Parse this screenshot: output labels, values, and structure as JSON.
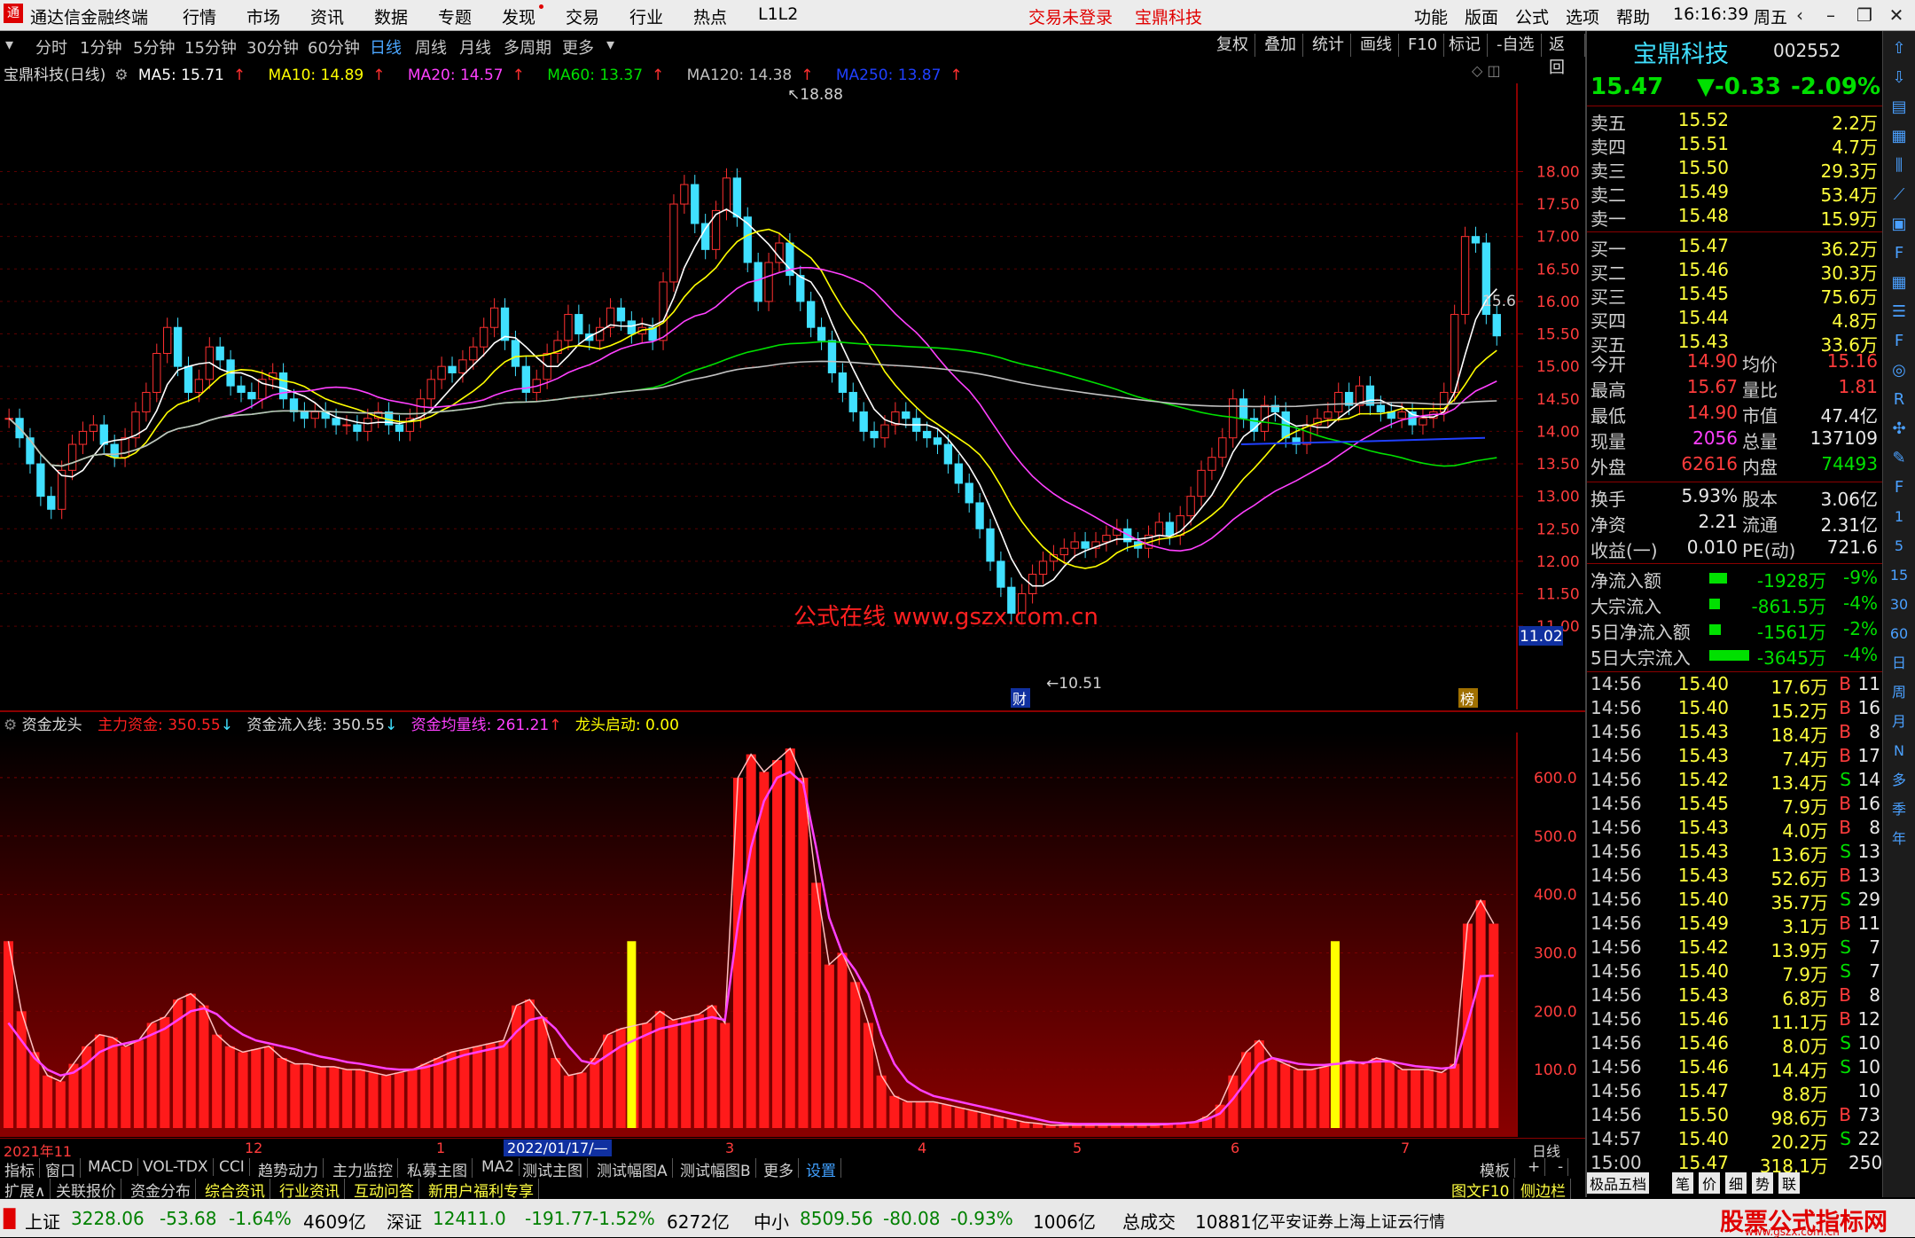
{
  "menubar": {
    "app_title": "通达信金融终端",
    "items": [
      "行情",
      "市场",
      "资讯",
      "数据",
      "专题",
      "发现",
      "交易",
      "行业",
      "热点",
      "L1L2"
    ],
    "notice1": "交易未登录",
    "notice2": "宝鼎科技",
    "right_items": [
      "功能",
      "版面",
      "公式",
      "选项",
      "帮助"
    ],
    "time": "16:16:39",
    "weekday": "周五"
  },
  "period": {
    "tabs": [
      "分时",
      "1分钟",
      "5分钟",
      "15分钟",
      "30分钟",
      "60分钟",
      "日线",
      "周线",
      "月线",
      "多周期",
      "更多"
    ],
    "active": "日线",
    "tools": [
      "复权",
      "叠加",
      "统计",
      "画线",
      "F10",
      "标记",
      "-自选",
      "返回"
    ]
  },
  "ma": {
    "title": "宝鼎科技(日线)",
    "items": [
      {
        "label": "MA5: 15.71",
        "color": "#ffffff"
      },
      {
        "label": "MA10: 14.89",
        "color": "#ffff00"
      },
      {
        "label": "MA20: 14.57",
        "color": "#ff40ff"
      },
      {
        "label": "MA60: 13.37",
        "color": "#00e000"
      },
      {
        "label": "MA120: 14.38",
        "color": "#c0c0c0"
      },
      {
        "label": "MA250: 13.87",
        "color": "#2040ff"
      }
    ]
  },
  "kline": {
    "y_ticks": [
      "18.00",
      "17.50",
      "17.00",
      "16.50",
      "16.00",
      "15.50",
      "15.00",
      "14.50",
      "14.00",
      "13.50",
      "13.00",
      "12.50",
      "12.00",
      "11.50",
      "11.02",
      "11.00"
    ],
    "high_label": "18.88",
    "low_label": "10.51",
    "last_label": "15.6",
    "current_price_box": "11.02",
    "watermark": "公式在线   www.gszx.com.cn",
    "marker1": "财",
    "marker2": "榜"
  },
  "indicator": {
    "name": "资金龙头",
    "items": [
      {
        "label": "主力资金: 350.55",
        "color": "#ff2020"
      },
      {
        "label": "资金流入线: 350.55",
        "color": "#d8d8d8"
      },
      {
        "label": "资金均量线: 261.21",
        "color": "#ff40ff"
      },
      {
        "label": "龙头启动: 0.00",
        "color": "#ffff00"
      }
    ],
    "y_ticks": [
      "600.0",
      "500.0",
      "400.0",
      "300.0",
      "200.0",
      "100.0"
    ]
  },
  "chart_data": {
    "type": "bar",
    "title": "资金龙头",
    "series": [
      {
        "name": "主力资金",
        "values": [
          320,
          200,
          130,
          90,
          80,
          110,
          140,
          160,
          155,
          140,
          150,
          180,
          190,
          220,
          230,
          210,
          160,
          140,
          130,
          135,
          140,
          120,
          110,
          110,
          105,
          105,
          100,
          100,
          95,
          90,
          95,
          100,
          110,
          120,
          130,
          135,
          140,
          145,
          150,
          210,
          220,
          190,
          120,
          90,
          95,
          120,
          160,
          170,
          175,
          180,
          200,
          185,
          190,
          195,
          210,
          180,
          600,
          640,
          610,
          630,
          650,
          600,
          420,
          280,
          300,
          250,
          180,
          90,
          55,
          45,
          45,
          45,
          40,
          35,
          30,
          25,
          20,
          15,
          10,
          8,
          5,
          5,
          5,
          5,
          5,
          5,
          5,
          5,
          5,
          6,
          8,
          10,
          20,
          40,
          90,
          130,
          150,
          120,
          110,
          100,
          100,
          105,
          110,
          115,
          110,
          120,
          115,
          100,
          100,
          100,
          95,
          110,
          350,
          390,
          350
        ]
      },
      {
        "name": "资金均量线",
        "values": [
          180,
          150,
          120,
          100,
          90,
          95,
          110,
          130,
          140,
          145,
          150,
          160,
          170,
          185,
          200,
          205,
          195,
          175,
          160,
          150,
          145,
          140,
          135,
          128,
          122,
          118,
          113,
          110,
          106,
          102,
          100,
          100,
          104,
          110,
          118,
          125,
          130,
          135,
          140,
          165,
          185,
          190,
          170,
          140,
          115,
          110,
          125,
          140,
          150,
          160,
          170,
          175,
          180,
          185,
          190,
          185,
          350,
          480,
          560,
          600,
          610,
          590,
          480,
          360,
          300,
          270,
          230,
          160,
          110,
          80,
          65,
          55,
          50,
          45,
          40,
          35,
          30,
          25,
          20,
          15,
          10,
          8,
          7,
          7,
          7,
          7,
          7,
          7,
          7,
          7,
          8,
          10,
          15,
          25,
          50,
          80,
          110,
          120,
          115,
          110,
          108,
          108,
          110,
          112,
          112,
          114,
          114,
          110,
          106,
          104,
          102,
          104,
          180,
          260,
          261
        ]
      },
      {
        "name": "龙头启动",
        "signals_at_category_index": [
          48,
          102
        ],
        "value": 320
      }
    ],
    "ylim": [
      0,
      650
    ],
    "x_ticks": [
      "2021年11",
      "12",
      "2022/01/17/—",
      "1",
      "3",
      "4",
      "5",
      "6",
      "7"
    ]
  },
  "quote": {
    "stock_name": "宝鼎科技",
    "stock_code": "002552",
    "price": "15.47",
    "change": "▼-0.33",
    "pct": "-2.09%",
    "asks": [
      {
        "label": "卖五",
        "price": "15.52",
        "vol": "2.2万"
      },
      {
        "label": "卖四",
        "price": "15.51",
        "vol": "4.7万"
      },
      {
        "label": "卖三",
        "price": "15.50",
        "vol": "29.3万"
      },
      {
        "label": "卖二",
        "price": "15.49",
        "vol": "53.4万"
      },
      {
        "label": "卖一",
        "price": "15.48",
        "vol": "15.9万"
      }
    ],
    "bids": [
      {
        "label": "买一",
        "price": "15.47",
        "vol": "36.2万"
      },
      {
        "label": "买二",
        "price": "15.46",
        "vol": "30.3万"
      },
      {
        "label": "买三",
        "price": "15.45",
        "vol": "75.6万"
      },
      {
        "label": "买四",
        "price": "15.44",
        "vol": "4.8万"
      },
      {
        "label": "买五",
        "price": "15.43",
        "vol": "33.6万"
      }
    ],
    "stats": [
      {
        "l1": "今开",
        "v1": "14.90",
        "c1": "red",
        "l2": "均价",
        "v2": "15.16",
        "c2": "red"
      },
      {
        "l1": "最高",
        "v1": "15.67",
        "c1": "red",
        "l2": "量比",
        "v2": "1.81",
        "c2": "red"
      },
      {
        "l1": "最低",
        "v1": "14.90",
        "c1": "red",
        "l2": "市值",
        "v2": "47.4亿",
        "c2": "wht"
      },
      {
        "l1": "现量",
        "v1": "2056",
        "c1": "pink",
        "l2": "总量",
        "v2": "137109",
        "c2": "wht"
      },
      {
        "l1": "外盘",
        "v1": "62616",
        "c1": "red",
        "l2": "内盘",
        "v2": "74493",
        "c2": "grn"
      }
    ],
    "stats2": [
      {
        "l1": "换手",
        "v1": "5.93%",
        "c1": "wht",
        "l2": "股本",
        "v2": "3.06亿",
        "c2": "wht"
      },
      {
        "l1": "净资",
        "v1": "2.21",
        "c1": "wht",
        "l2": "流通",
        "v2": "2.31亿",
        "c2": "wht"
      },
      {
        "l1": "收益(一)",
        "v1": "0.010",
        "c1": "wht",
        "l2": "PE(动)",
        "v2": "721.6",
        "c2": "wht"
      }
    ],
    "flows": [
      {
        "label": "净流入额",
        "val": "-1928万",
        "pct": "-9%",
        "bar": 0.2
      },
      {
        "label": "大宗流入",
        "val": "-861.5万",
        "pct": "-4%",
        "bar": 0.08
      },
      {
        "label": "5日净流入额",
        "val": "-1561万",
        "pct": "-2%",
        "bar": 0.1
      },
      {
        "label": "5日大宗流入",
        "val": "-3645万",
        "pct": "-4%",
        "bar": 0.55
      }
    ],
    "ticks": [
      {
        "t": "14:56",
        "p": "15.40",
        "v": "17.6万",
        "d": "B",
        "n": "11"
      },
      {
        "t": "14:56",
        "p": "15.40",
        "v": "15.2万",
        "d": "B",
        "n": "16"
      },
      {
        "t": "14:56",
        "p": "15.43",
        "v": "18.4万",
        "d": "B",
        "n": "8"
      },
      {
        "t": "14:56",
        "p": "15.43",
        "v": "7.4万",
        "d": "B",
        "n": "17"
      },
      {
        "t": "14:56",
        "p": "15.42",
        "v": "13.4万",
        "d": "S",
        "n": "14"
      },
      {
        "t": "14:56",
        "p": "15.45",
        "v": "7.9万",
        "d": "B",
        "n": "16"
      },
      {
        "t": "14:56",
        "p": "15.43",
        "v": "4.0万",
        "d": "B",
        "n": "8"
      },
      {
        "t": "14:56",
        "p": "15.43",
        "v": "13.6万",
        "d": "S",
        "n": "13"
      },
      {
        "t": "14:56",
        "p": "15.43",
        "v": "52.6万",
        "d": "B",
        "n": "13"
      },
      {
        "t": "14:56",
        "p": "15.40",
        "v": "35.7万",
        "d": "S",
        "n": "29"
      },
      {
        "t": "14:56",
        "p": "15.49",
        "v": "3.1万",
        "d": "B",
        "n": "11"
      },
      {
        "t": "14:56",
        "p": "15.42",
        "v": "13.9万",
        "d": "S",
        "n": "7"
      },
      {
        "t": "14:56",
        "p": "15.40",
        "v": "7.9万",
        "d": "S",
        "n": "7"
      },
      {
        "t": "14:56",
        "p": "15.43",
        "v": "6.8万",
        "d": "B",
        "n": "8"
      },
      {
        "t": "14:56",
        "p": "15.46",
        "v": "11.1万",
        "d": "B",
        "n": "12"
      },
      {
        "t": "14:56",
        "p": "15.46",
        "v": "8.0万",
        "d": "S",
        "n": "10"
      },
      {
        "t": "14:56",
        "p": "15.46",
        "v": "14.4万",
        "d": "S",
        "n": "10"
      },
      {
        "t": "14:56",
        "p": "15.47",
        "v": "8.8万",
        "d": "",
        "n": "10"
      },
      {
        "t": "14:56",
        "p": "15.50",
        "v": "98.6万",
        "d": "B",
        "n": "73"
      },
      {
        "t": "14:57",
        "p": "15.40",
        "v": "20.2万",
        "d": "S",
        "n": "22"
      },
      {
        "t": "15:00",
        "p": "15.47",
        "v": "318.1万",
        "d": "",
        "n": "250"
      }
    ],
    "bottom_tabs": [
      "极品五档",
      "笔",
      "价",
      "细",
      "势",
      "联"
    ]
  },
  "iconstrip": [
    "up-arrow-icon",
    "down-arrow-icon",
    "chart-icon",
    "table-icon",
    "kline-icon",
    "trend-icon",
    "book-icon",
    "f10-icon",
    "grid-icon",
    "list-icon",
    "fs-icon",
    "circle-icon",
    "rsi-icon",
    "cross-icon",
    "pencil-icon",
    "fs2-icon",
    "1",
    "5",
    "15",
    "30",
    "60",
    "日",
    "周",
    "月",
    "N",
    "多",
    "季",
    "年"
  ],
  "tabs1": [
    "指标",
    "窗口",
    "MACD",
    "VOL-TDX",
    "CCI",
    "趋势动力",
    "主力监控",
    "私募主图",
    "MA2",
    "测试主图",
    "测试幅图A",
    "测试幅图B",
    "更多",
    "设置"
  ],
  "tabs1_right": [
    "模板",
    "+",
    "-"
  ],
  "tabs2": [
    "扩展∧",
    "关联报价",
    "资金分布",
    "综合资讯",
    "行业资讯",
    "互动问答",
    "新用户福利专享"
  ],
  "tabs2_right": [
    "图文F10",
    "侧边栏"
  ],
  "chart_xlabel_right": "日线",
  "status": {
    "sh": {
      "name": "上证",
      "val": "3228.06",
      "chg": "-53.68",
      "pct": "-1.64%",
      "amt": "4609亿"
    },
    "sz": {
      "name": "深证",
      "val": "12411.0",
      "chg": "-191.77",
      "pct": "-1.52%",
      "amt": "6272亿"
    },
    "zx": {
      "name": "中小",
      "val": "8509.56",
      "chg": "-80.08",
      "pct": "-0.93%",
      "amt": "1006亿"
    },
    "total_label": "总成交",
    "total": "10881亿",
    "feed": "平安证券上海上证云行情",
    "brand": "股票公式指标网",
    "brand_url": "www.gszx.com.cn"
  }
}
